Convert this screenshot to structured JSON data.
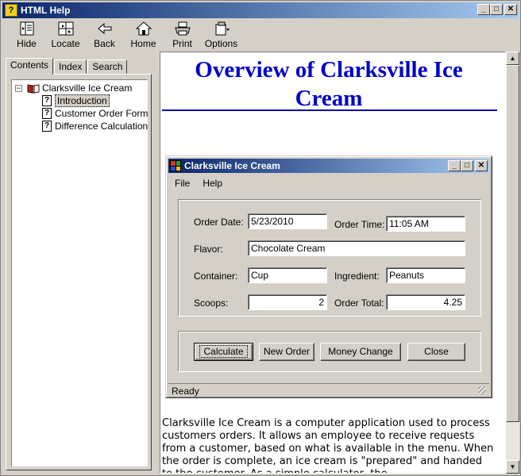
{
  "window": {
    "title": "HTML Help"
  },
  "toolbar": {
    "buttons": [
      {
        "id": "hide",
        "label": "Hide",
        "icon": "hide-icon"
      },
      {
        "id": "locate",
        "label": "Locate",
        "icon": "locate-icon"
      },
      {
        "id": "back",
        "label": "Back",
        "icon": "back-arrow-icon"
      },
      {
        "id": "home",
        "label": "Home",
        "icon": "home-icon"
      },
      {
        "id": "print",
        "label": "Print",
        "icon": "printer-icon"
      },
      {
        "id": "options",
        "label": "Options",
        "icon": "options-icon"
      }
    ]
  },
  "navpane": {
    "tabs": [
      "Contents",
      "Index",
      "Search"
    ],
    "tree": {
      "root": "Clarksville Ice Cream",
      "children": [
        "Introduction",
        "Customer Order Form",
        "Difference Calculation"
      ]
    }
  },
  "topic": {
    "heading": "Overview of Clarksville Ice Cream",
    "form": {
      "title": "Clarksville Ice Cream",
      "menu": [
        "File",
        "Help"
      ],
      "labels": {
        "order_date": "Order Date:",
        "order_time": "Order Time:",
        "flavor": "Flavor:",
        "container": "Container:",
        "ingredient": "Ingredient:",
        "scoops": "Scoops:",
        "order_total": "Order Total:"
      },
      "values": {
        "order_date": "5/23/2010",
        "order_time": "11:05 AM",
        "flavor": "Chocolate Cream",
        "container": "Cup",
        "ingredient": "Peanuts",
        "scoops": "2",
        "order_total": "4.25"
      },
      "buttons": {
        "calculate": "Calculate",
        "new_order": "New Order",
        "money_change": "Money Change",
        "close": "Close"
      },
      "status": "Ready"
    },
    "paragraph": "Clarksville Ice Cream is a computer application used to process customers orders. It allows an employee to receive requests from a customer, based on what is available in the menu. When the order is complete, an ice cream is \"prepared\" and handed to the customer. As a simple calculator, the"
  },
  "colors": {
    "heading": "#0000cc",
    "titlebar_start": "#0a246a",
    "titlebar_end": "#a6caf0"
  }
}
